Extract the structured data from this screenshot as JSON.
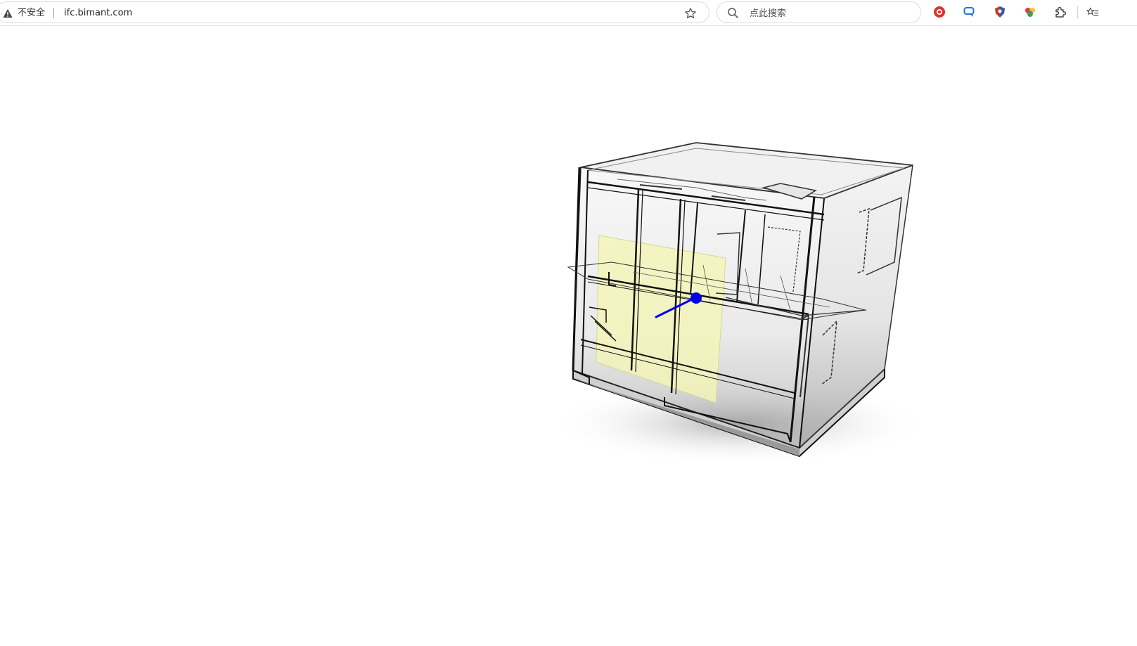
{
  "browser": {
    "security_label": "不安全",
    "url": "ifc.bimant.com",
    "search_placeholder": "点此搜索",
    "icons": {
      "security": "warning-triangle-icon",
      "bookmark": "star-icon",
      "search": "magnifier-icon",
      "extensions": [
        "red-record-extension-icon",
        "blue-translate-extension-icon",
        "shield-extension-icon",
        "colorful-extension-icon",
        "puzzle-extensions-icon",
        "favorites-list-icon"
      ]
    }
  },
  "viewer": {
    "colors": {
      "background": "#ffffff",
      "section_plane": "#f5f5b8",
      "gizmo": "#0000ee",
      "edges": "#111111"
    }
  }
}
